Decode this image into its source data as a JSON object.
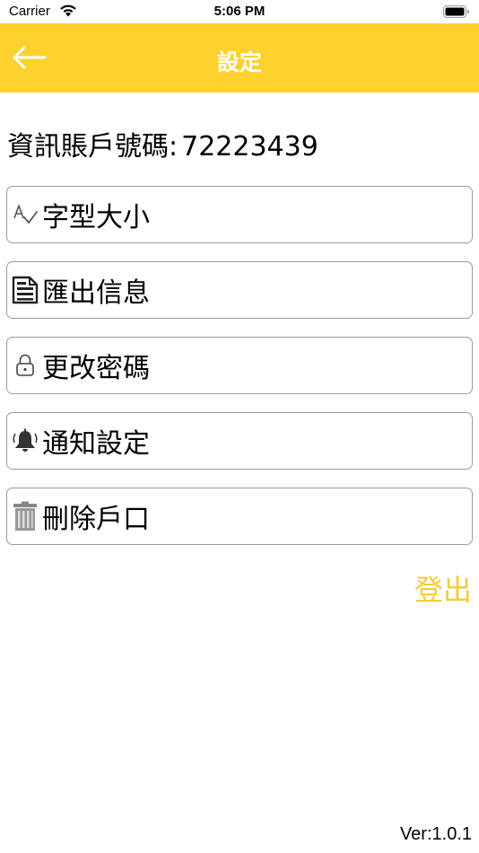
{
  "status_bar": {
    "carrier": "Carrier",
    "time": "5:06 PM",
    "wifi_icon": "wifi-icon",
    "battery_icon": "battery-icon"
  },
  "nav": {
    "title": "設定",
    "back_icon": "arrow-left-icon",
    "background_color": "#fdd22f",
    "title_color": "#ffffff"
  },
  "account": {
    "label": "資訊賬戶號碼",
    "separator": ":",
    "number": "72223439"
  },
  "menu": [
    {
      "label": "字型大小",
      "icon": "font-size-icon"
    },
    {
      "label": "匯出信息",
      "icon": "document-icon"
    },
    {
      "label": "更改密碼",
      "icon": "lock-icon"
    },
    {
      "label": "通知設定",
      "icon": "bell-icon"
    },
    {
      "label": "刪除戶口",
      "icon": "trash-icon"
    }
  ],
  "logout": {
    "label": "登出",
    "color": "#f6cb3c"
  },
  "version": "Ver:1.0.1"
}
